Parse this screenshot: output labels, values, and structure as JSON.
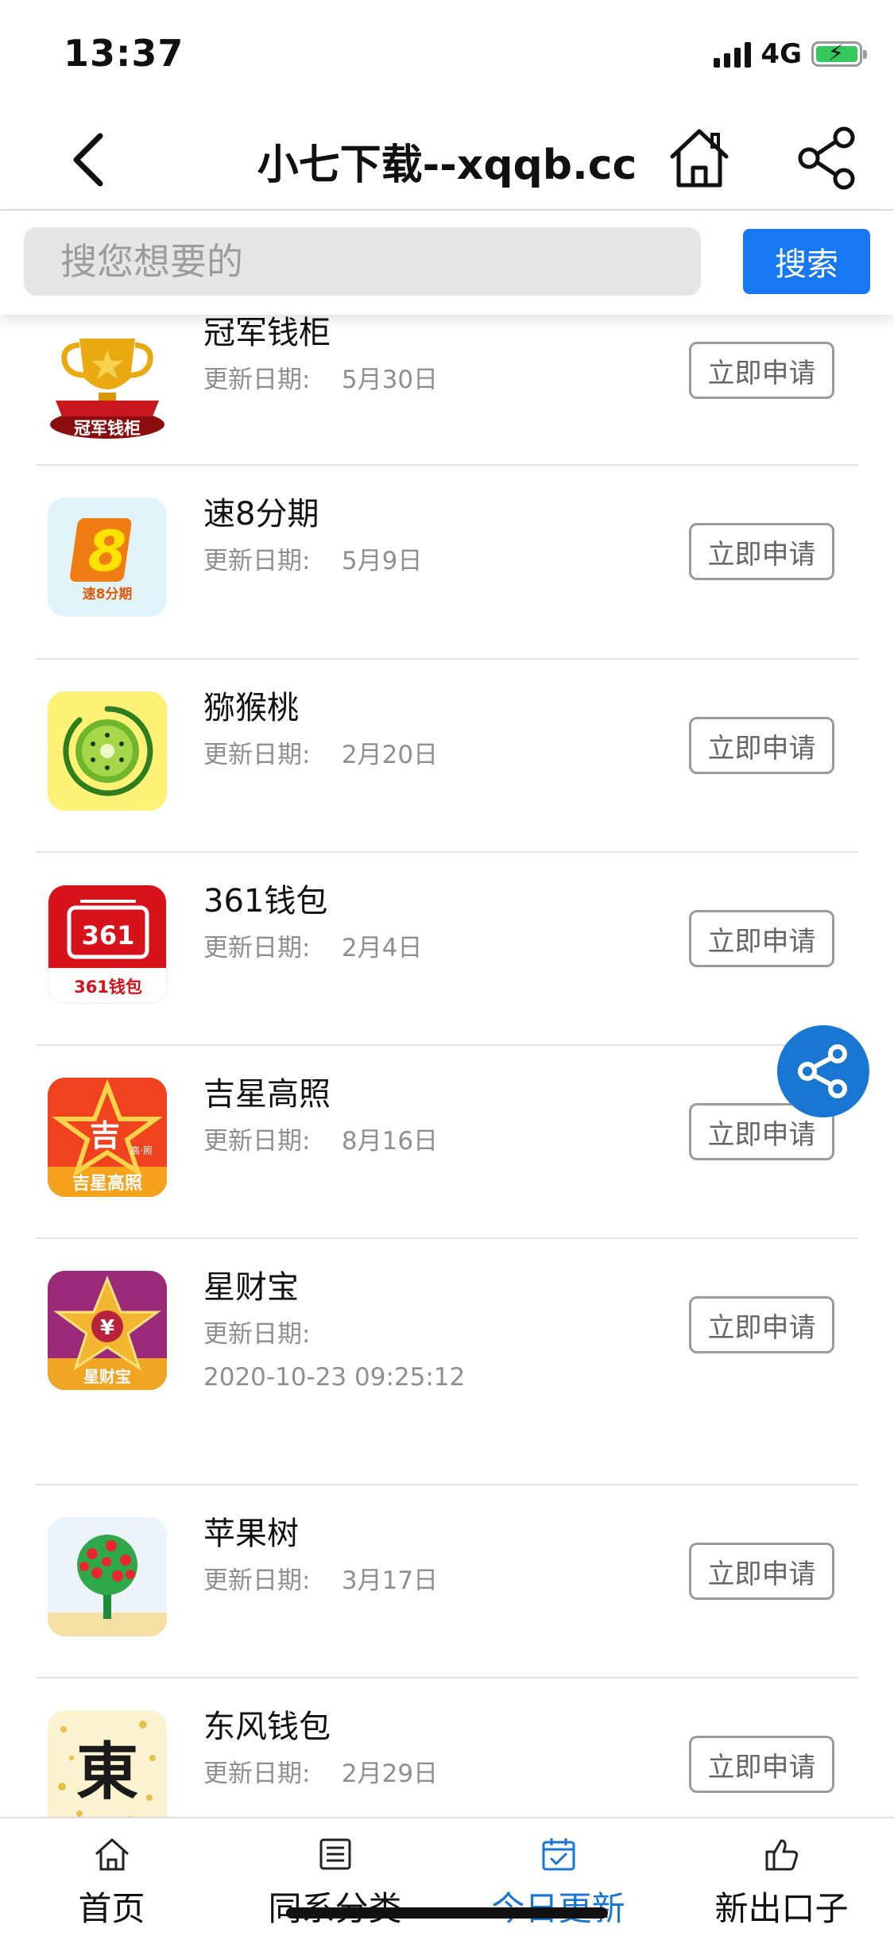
{
  "status": {
    "time": "13:37",
    "network": "4G"
  },
  "nav": {
    "title": "小七下载--xqqb.cc",
    "back_icon": "chevron-left-icon",
    "home_icon": "home-icon",
    "share_icon": "share-icon"
  },
  "search": {
    "placeholder": "搜您想要的",
    "button_label": "搜索"
  },
  "list": {
    "items": [
      {
        "name": "冠军钱柜",
        "date_label": "更新日期:",
        "date": "5月30日",
        "button": "立即申请",
        "icon_text": "冠军钱柜"
      },
      {
        "name": "速8分期",
        "date_label": "更新日期:",
        "date": "5月9日",
        "button": "立即申请",
        "icon_text": "速8分期"
      },
      {
        "name": "猕猴桃",
        "date_label": "更新日期:",
        "date": "2月20日",
        "button": "立即申请"
      },
      {
        "name": "361钱包",
        "date_label": "更新日期:",
        "date": "2月4日",
        "button": "立即申请",
        "icon_text": "361钱包"
      },
      {
        "name": "吉星高照",
        "date_label": "更新日期:",
        "date": "8月16日",
        "button": "立即申请",
        "icon_text": "吉星高照"
      },
      {
        "name": "星财宝",
        "date_label": "更新日期:",
        "date": "2020-10-23 09:25:12",
        "button": "立即申请",
        "icon_text": "星财宝"
      },
      {
        "name": "苹果树",
        "date_label": "更新日期:",
        "date": "3月17日",
        "button": "立即申请"
      },
      {
        "name": "东风钱包",
        "date_label": "更新日期:",
        "date": "2月29日",
        "button": "立即申请",
        "icon_text": "東"
      }
    ]
  },
  "fab": {
    "icon": "share-icon"
  },
  "tabs": [
    {
      "label": "首页",
      "icon": "home-icon"
    },
    {
      "label": "同系分类",
      "icon": "list-icon"
    },
    {
      "label": "今日更新",
      "icon": "calendar-check-icon",
      "active": true
    },
    {
      "label": "新出口子",
      "icon": "thumbs-up-icon"
    }
  ],
  "colors": {
    "accent": "#1976d2",
    "search_button": "#1877f2",
    "battery": "#34c759"
  }
}
